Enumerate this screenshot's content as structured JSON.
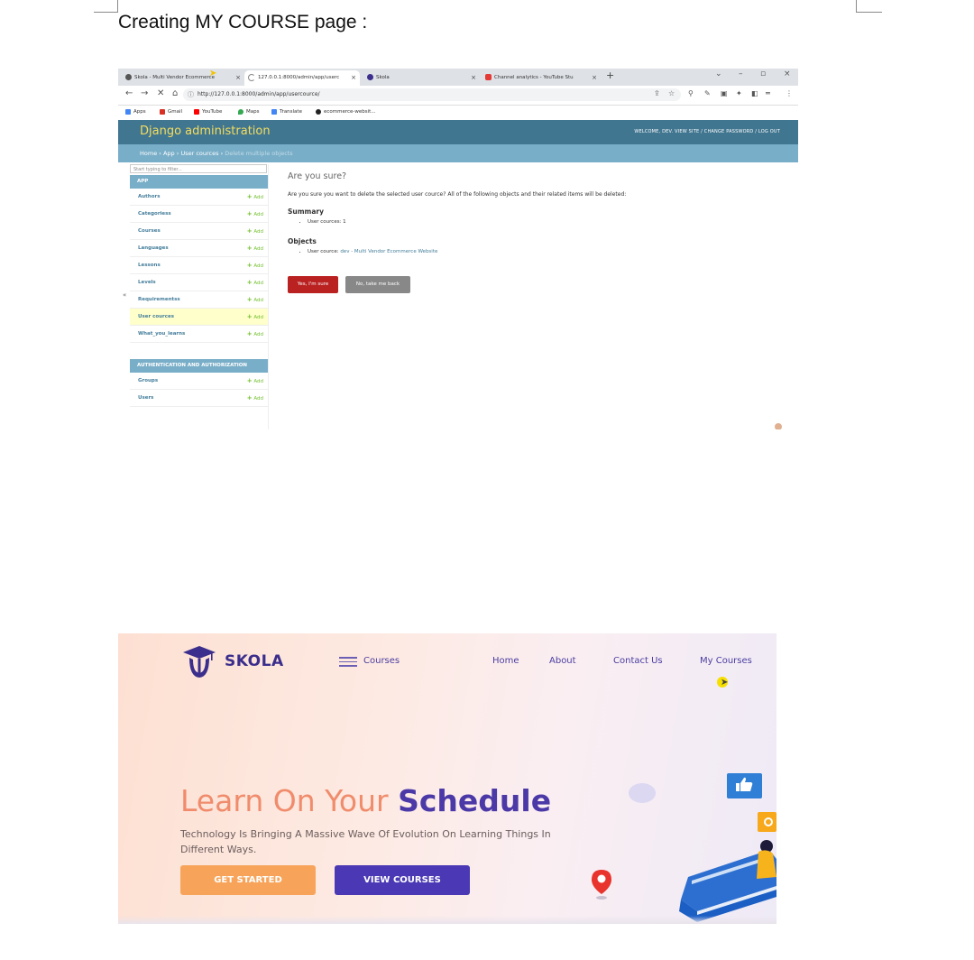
{
  "document": {
    "heading": "Creating MY COURSE page :"
  },
  "browser": {
    "tabs": [
      {
        "title": "Skola - Multi Vendor Ecommerce",
        "icon_color": "#555555"
      },
      {
        "title": "127.0.0.1:8000/admin/app/userc",
        "icon_color": "#888888"
      },
      {
        "title": "Skola",
        "icon_color": "#3b2e8c"
      },
      {
        "title": "Channel analytics - YouTube Stu",
        "icon_color": "#e53935"
      }
    ],
    "close_glyph": "×",
    "new_tab": "+",
    "window_controls": [
      "⌄",
      "–",
      "▫",
      "×"
    ],
    "url": "http://127.0.0.1:8000/admin/app/usercource/",
    "bookmarks": [
      {
        "label": "Apps",
        "color": "#4285f4"
      },
      {
        "label": "Gmail",
        "color": "#d93025"
      },
      {
        "label": "YouTube",
        "color": "#ff0000"
      },
      {
        "label": "Maps",
        "color": "#34a853"
      },
      {
        "label": "Translate",
        "color": "#4285f4"
      },
      {
        "label": "ecommerce-websit...",
        "color": "#222222"
      }
    ]
  },
  "django": {
    "site_title": "Django administration",
    "user_tools": "WELCOME, DEV. VIEW SITE / CHANGE PASSWORD / LOG OUT",
    "breadcrumbs": {
      "home": "Home",
      "app": "App",
      "model": "User cources",
      "current": "Delete multiple objects",
      "sep": "›"
    },
    "filter_placeholder": "Start typing to filter...",
    "collapse_glyph": "«",
    "modules": [
      {
        "caption": "APP",
        "rows": [
          {
            "label": "Authors",
            "selected": false
          },
          {
            "label": "Categoriess",
            "selected": false
          },
          {
            "label": "Courses",
            "selected": false
          },
          {
            "label": "Languages",
            "selected": false
          },
          {
            "label": "Lessons",
            "selected": false
          },
          {
            "label": "Levels",
            "selected": false
          },
          {
            "label": "Requirementss",
            "selected": false
          },
          {
            "label": "User cources",
            "selected": true
          },
          {
            "label": "What_you_learns",
            "selected": false
          }
        ]
      },
      {
        "caption": "AUTHENTICATION AND AUTHORIZATION",
        "rows": [
          {
            "label": "Groups",
            "selected": false
          },
          {
            "label": "Users",
            "selected": false
          }
        ]
      }
    ],
    "add_label": "Add",
    "heading": "Are you sure?",
    "confirm_text": "Are you sure you want to delete the selected user cource? All of the following objects and their related items will be deleted:",
    "summary_title": "Summary",
    "summary_item": "User cources: 1",
    "objects_title": "Objects",
    "object_prefix": "User cource:",
    "object_link": "dev - Multi Vendor Ecommerce Website",
    "yes_button": "Yes, I'm sure",
    "no_button": "No, take me back"
  },
  "skola": {
    "brand": "SKOLA",
    "menu_label": "Courses",
    "nav": [
      {
        "label": "Home"
      },
      {
        "label": "About"
      },
      {
        "label": "Contact Us"
      },
      {
        "label": "My Courses"
      }
    ],
    "headline_part1": "Learn On Your",
    "headline_part2": "Schedule",
    "subtitle": "Technology Is Bringing A Massive Wave Of Evolution On Learning Things In Different Ways.",
    "get_started": "GET STARTED",
    "view_courses": "VIEW COURSES",
    "colors": {
      "brand": "#3b2e8c",
      "accent_orange": "#f7a45a",
      "accent_purple": "#4a38b4"
    }
  }
}
